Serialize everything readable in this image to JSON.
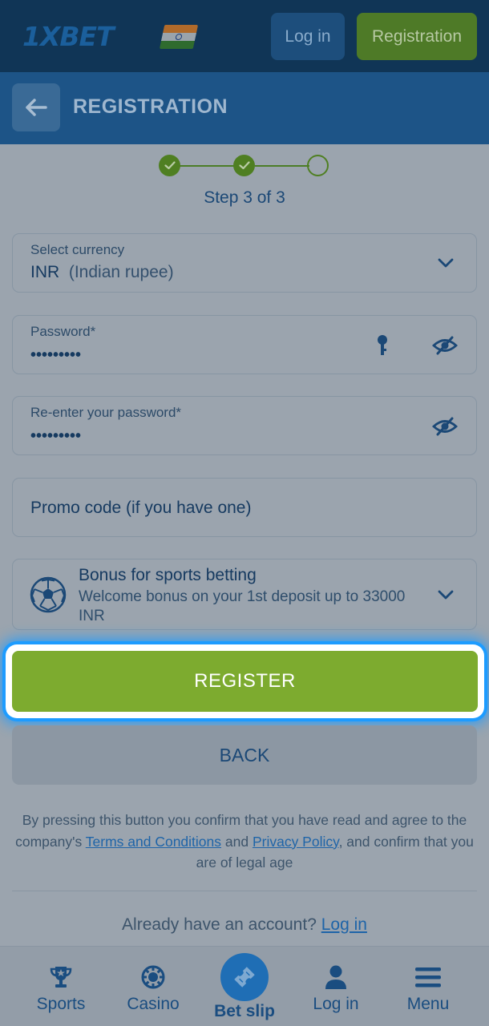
{
  "header": {
    "logo_text": "1XBET",
    "login_label": "Log in",
    "registration_label": "Registration"
  },
  "subheader": {
    "title": "REGISTRATION"
  },
  "steps": {
    "label": "Step 3 of 3",
    "completed": 2,
    "total": 3
  },
  "form": {
    "currency": {
      "label": "Select currency",
      "code": "INR",
      "name": "(Indian rupee)"
    },
    "password": {
      "label": "Password*",
      "value": "•••••••••"
    },
    "repassword": {
      "label": "Re-enter your password*",
      "value": "•••••••••"
    },
    "promo": {
      "placeholder": "Promo code (if you have one)"
    },
    "bonus": {
      "title": "Bonus for sports betting",
      "description": "Welcome bonus on your 1st deposit up to 33000 INR"
    }
  },
  "actions": {
    "register_label": "REGISTER",
    "back_label": "BACK"
  },
  "legal": {
    "before": "By pressing this button you confirm that you have read and agree to the company's ",
    "terms": "Terms and Conditions",
    "middle": " and ",
    "privacy": "Privacy Policy",
    "after": ", and confirm that you are of legal age"
  },
  "account": {
    "prompt": "Already have an account? ",
    "link": "Log in"
  },
  "bottom_nav": {
    "sports": "Sports",
    "casino": "Casino",
    "betslip": "Bet slip",
    "login": "Log in",
    "menu": "Menu"
  },
  "colors": {
    "accent_green": "#7dab2f",
    "header_blue": "#103556",
    "highlight_blue": "#1e9cff"
  }
}
